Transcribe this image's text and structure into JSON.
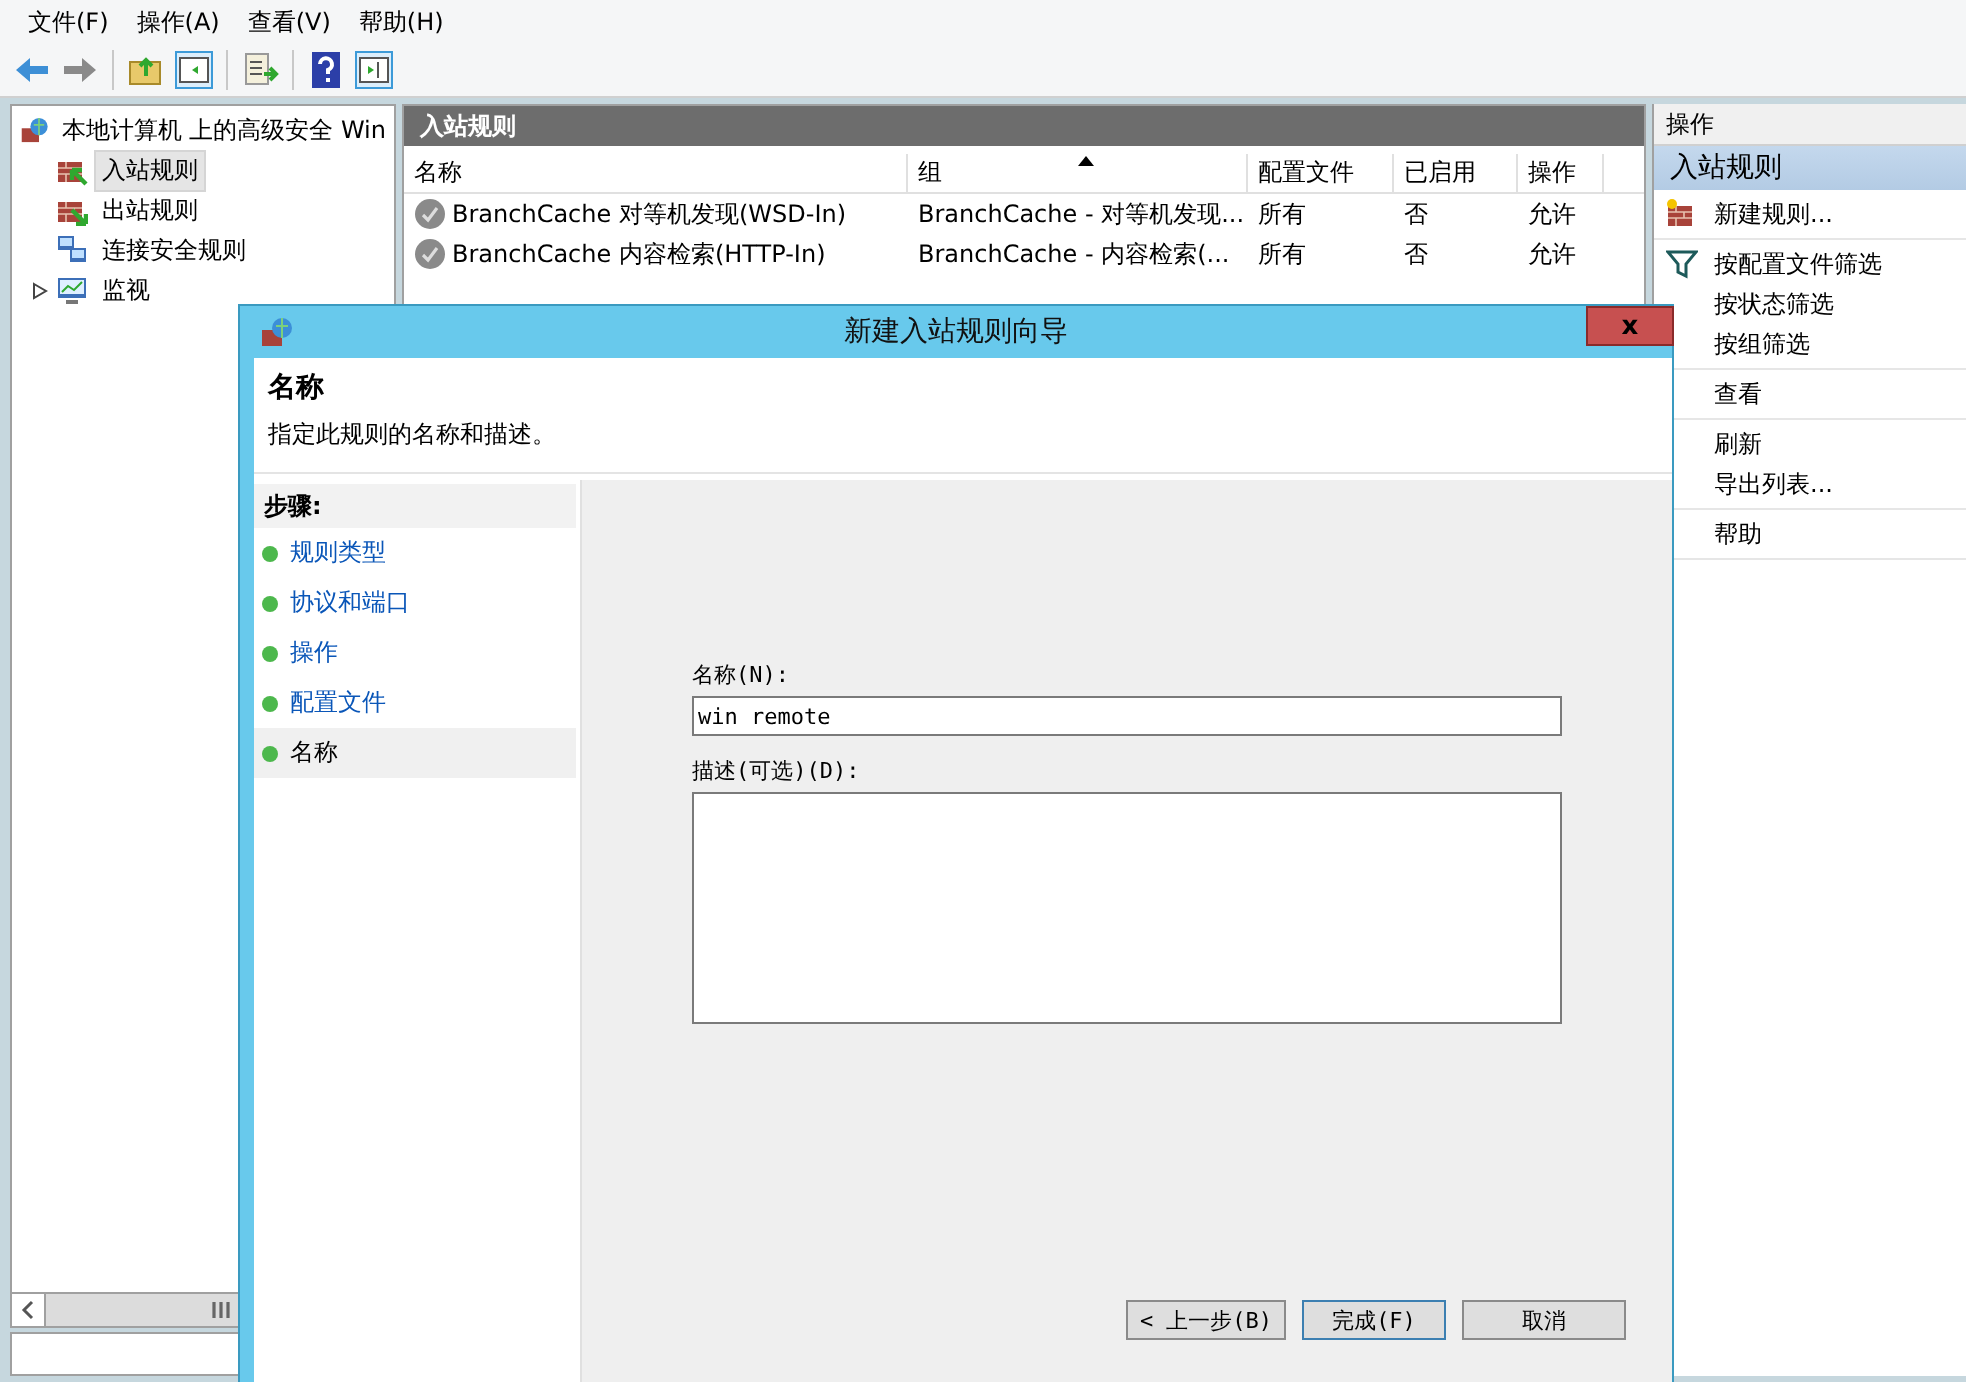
{
  "menu": [
    {
      "label": "文件(F)"
    },
    {
      "label": "操作(A)"
    },
    {
      "label": "查看(V)"
    },
    {
      "label": "帮助(H)"
    }
  ],
  "tree": {
    "label": "本地计算机 上的高级安全 Win",
    "children": [
      {
        "label": "入站规则",
        "kind": "inbound",
        "selected": true
      },
      {
        "label": "出站规则",
        "kind": "outbound",
        "selected": false
      },
      {
        "label": "连接安全规则",
        "kind": "connection",
        "selected": false
      },
      {
        "label": "监视",
        "kind": "monitor",
        "selected": false,
        "expanded": false
      }
    ]
  },
  "rules": {
    "title": "入站规则",
    "columns": [
      {
        "label": "名称",
        "sorted": false
      },
      {
        "label": "组",
        "sorted": true
      },
      {
        "label": "配置文件",
        "sorted": false
      },
      {
        "label": "已启用",
        "sorted": false
      },
      {
        "label": "操作",
        "sorted": false
      }
    ],
    "rows": [
      {
        "cells": [
          "BranchCache 对等机发现(WSD-In)",
          "BranchCache - 对等机发现...",
          "所有",
          "否",
          "允许"
        ]
      },
      {
        "cells": [
          "BranchCache 内容检索(HTTP-In)",
          "BranchCache - 内容检索(...",
          "所有",
          "否",
          "允许"
        ]
      }
    ]
  },
  "actions": {
    "title": "操作",
    "section": "入站规则",
    "groups": [
      {
        "items": [
          {
            "label": "新建规则...",
            "kind": "new-rule"
          }
        ]
      },
      {
        "items": [
          {
            "label": "按配置文件筛选",
            "kind": "filter"
          },
          {
            "label": "按状态筛选",
            "kind": "plain"
          },
          {
            "label": "按组筛选",
            "kind": "plain"
          }
        ]
      },
      {
        "items": [
          {
            "label": "查看",
            "kind": "plain"
          }
        ]
      },
      {
        "items": [
          {
            "label": "刷新",
            "kind": "plain"
          },
          {
            "label": "导出列表...",
            "kind": "plain"
          }
        ]
      },
      {
        "items": [
          {
            "label": "帮助",
            "kind": "plain"
          }
        ]
      }
    ]
  },
  "dialog": {
    "title": "新建入站规则向导",
    "close_label": "x",
    "heading": "名称",
    "description": "指定此规则的名称和描述。",
    "steps_title": "步骤:",
    "steps": [
      {
        "label": "规则类型",
        "selected": false
      },
      {
        "label": "协议和端口",
        "selected": false
      },
      {
        "label": "操作",
        "selected": false
      },
      {
        "label": "配置文件",
        "selected": false
      },
      {
        "label": "名称",
        "selected": true
      }
    ],
    "name_label": "名称(N):",
    "name_value": "win remote",
    "desc_label": "描述(可选)(D):",
    "buttons": [
      {
        "label": "< 上一步(B)",
        "default": false
      },
      {
        "label": "完成(F)",
        "default": true
      },
      {
        "label": "取消",
        "default": false
      }
    ]
  }
}
